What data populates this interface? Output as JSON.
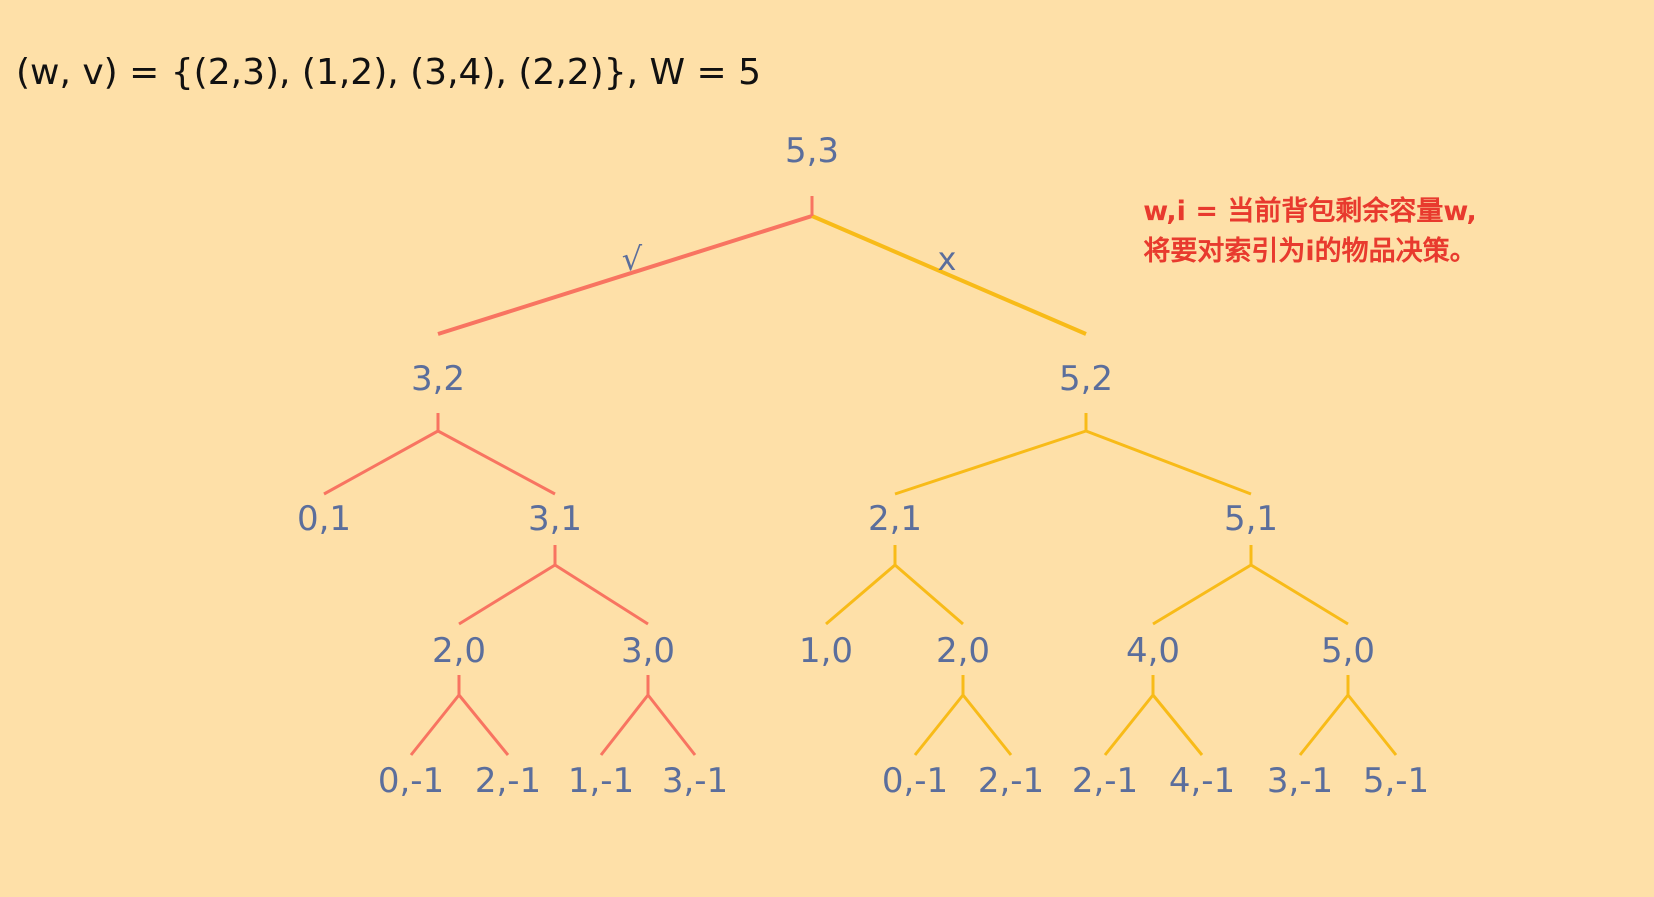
{
  "problem": "(w, v) = {(2,3), (1,2), (3,4), (2,2)}, W = 5",
  "legend": {
    "line1": "w,i = 当前背包剩余容量w,",
    "line2": "将要对索引为i的物品决策。"
  },
  "edge_marks": {
    "take": "√",
    "skip": "x"
  },
  "colors": {
    "take": "#f87461",
    "skip": "#f8bb18",
    "label": "#5b6e9c",
    "legend": "#e83a2e",
    "background": "#fee0a8"
  },
  "tree": {
    "label": "5,3",
    "children": [
      {
        "label": "3,2",
        "children": [
          {
            "label": "0,1"
          },
          {
            "label": "3,1",
            "children": [
              {
                "label": "2,0",
                "children": [
                  {
                    "label": "0,-1"
                  },
                  {
                    "label": "2,-1"
                  }
                ]
              },
              {
                "label": "3,0",
                "children": [
                  {
                    "label": "1,-1"
                  },
                  {
                    "label": "3,-1"
                  }
                ]
              }
            ]
          }
        ]
      },
      {
        "label": "5,2",
        "children": [
          {
            "label": "2,1",
            "children": [
              {
                "label": "1,0"
              },
              {
                "label": "2,0",
                "children": [
                  {
                    "label": "0,-1"
                  },
                  {
                    "label": "2,-1"
                  }
                ]
              }
            ]
          },
          {
            "label": "5,1",
            "children": [
              {
                "label": "4,0",
                "children": [
                  {
                    "label": "2,-1"
                  },
                  {
                    "label": "4,-1"
                  }
                ]
              },
              {
                "label": "5,0",
                "children": [
                  {
                    "label": "3,-1"
                  },
                  {
                    "label": "5,-1"
                  }
                ]
              }
            ]
          }
        ]
      }
    ]
  }
}
